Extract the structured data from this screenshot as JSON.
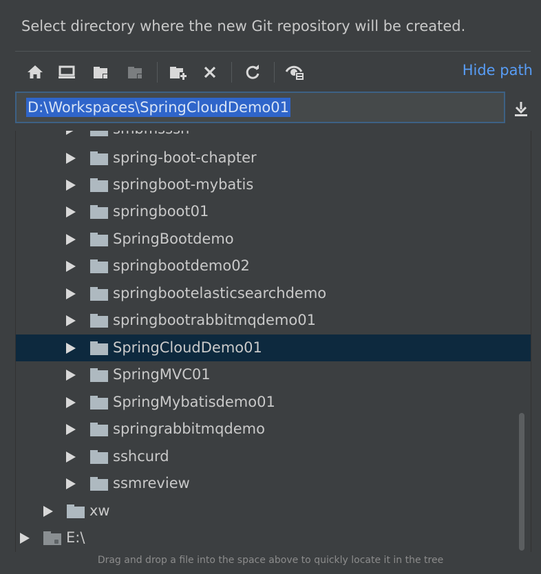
{
  "header": {
    "text": "Select directory where the new Git repository will be created."
  },
  "toolbar": {
    "buttons": [
      {
        "icon": "home-icon"
      },
      {
        "icon": "desktop-icon"
      },
      {
        "icon": "project-icon"
      },
      {
        "icon": "module-icon"
      },
      {
        "icon": "new-folder-icon"
      },
      {
        "icon": "delete-icon"
      },
      {
        "icon": "refresh-icon"
      },
      {
        "icon": "show-hidden-icon"
      }
    ],
    "hide_path_label": "Hide path"
  },
  "path": {
    "value": "D:\\Workspaces\\SpringCloudDemo01"
  },
  "tree": {
    "partial_top_label": "smbmsssh",
    "items": [
      {
        "label": "spring-boot-chapter"
      },
      {
        "label": "springboot-mybatis"
      },
      {
        "label": "springboot01"
      },
      {
        "label": "SpringBootdemo"
      },
      {
        "label": "springbootdemo02"
      },
      {
        "label": "springbootelasticsearchdemo"
      },
      {
        "label": "springbootrabbitmqdemo01"
      },
      {
        "label": "SpringCloudDemo01"
      },
      {
        "label": "SpringMVC01"
      },
      {
        "label": "SpringMybatisdemo01"
      },
      {
        "label": "springrabbitmqdemo"
      },
      {
        "label": "sshcurd"
      },
      {
        "label": "ssmreview"
      }
    ],
    "selected_label": "SpringCloudDemo01",
    "parent_sibling": {
      "label": "xw"
    },
    "drive": {
      "label": "E:\\"
    }
  },
  "footer": {
    "hint": "Drag and drop a file into the space above to quickly locate it in the tree"
  },
  "colors": {
    "background": "#3c3f41",
    "selection": "#0d293e",
    "accent_link": "#589df6",
    "text_selection": "#2f65ca"
  }
}
